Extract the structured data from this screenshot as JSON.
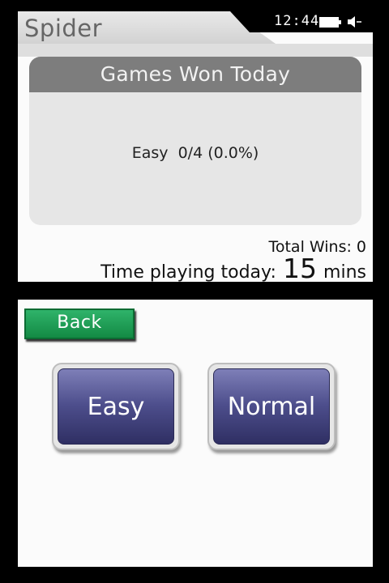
{
  "app": {
    "title": "Spider"
  },
  "status": {
    "time": "12:44"
  },
  "stats": {
    "header": "Games Won Today",
    "line": "Easy  0/4 (0.0%)",
    "total_wins": "Total Wins: 0",
    "time_label": "Time playing today:",
    "time_value": "15",
    "time_unit": "mins"
  },
  "controls": {
    "back_label": "Back",
    "easy_label": "Easy",
    "normal_label": "Normal"
  },
  "icons": {
    "battery": "battery-icon",
    "volume": "volume-icon"
  },
  "colors": {
    "back_green": "#1f9d55",
    "button_navy": "#4d4e8c",
    "panel_header": "#7d7d7d"
  }
}
